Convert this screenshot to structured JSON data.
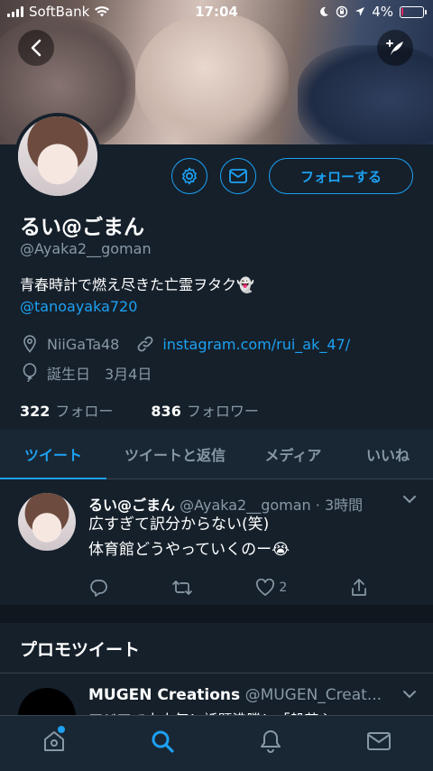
{
  "status_bar": {
    "carrier": "SoftBank",
    "time": "17:04",
    "battery": "4%",
    "battery_level": 0.04
  },
  "profile": {
    "display_name": "るい@ごまん",
    "handle": "@Ayaka2__goman",
    "bio": "青春時計で燃え尽きた亡霊ヲタク👻",
    "bio_mention": "@tanoayaka720",
    "location": "NiiGaTa48",
    "website": "instagram.com/rui_ak_47/",
    "birthday": "誕生日　3月4日",
    "following_count": "322",
    "following_label": "フォロー",
    "followers_count": "836",
    "followers_label": "フォロワー",
    "follow_button": "フォローする"
  },
  "tabs": [
    {
      "label": "ツイート",
      "active": true
    },
    {
      "label": "ツイートと返信",
      "active": false
    },
    {
      "label": "メディア",
      "active": false
    },
    {
      "label": "いいね",
      "active": false
    }
  ],
  "tweet": {
    "name": "るい@ごまん",
    "handle_time": "@Ayaka2__goman · 3時間",
    "line1": "広すぎて訳分からない(笑)",
    "line2": "体育館どうやっていくのー😭",
    "like_count": "2"
  },
  "promo": {
    "section_title": "プロモツイート",
    "name": "MUGEN Creations",
    "handle": "@MUGEN_Creat...",
    "text": "アジアで大人気！話題沸騰！「般若心"
  },
  "colors": {
    "background": "#15202b",
    "accent": "#1da1f2",
    "muted": "#8899a6"
  }
}
